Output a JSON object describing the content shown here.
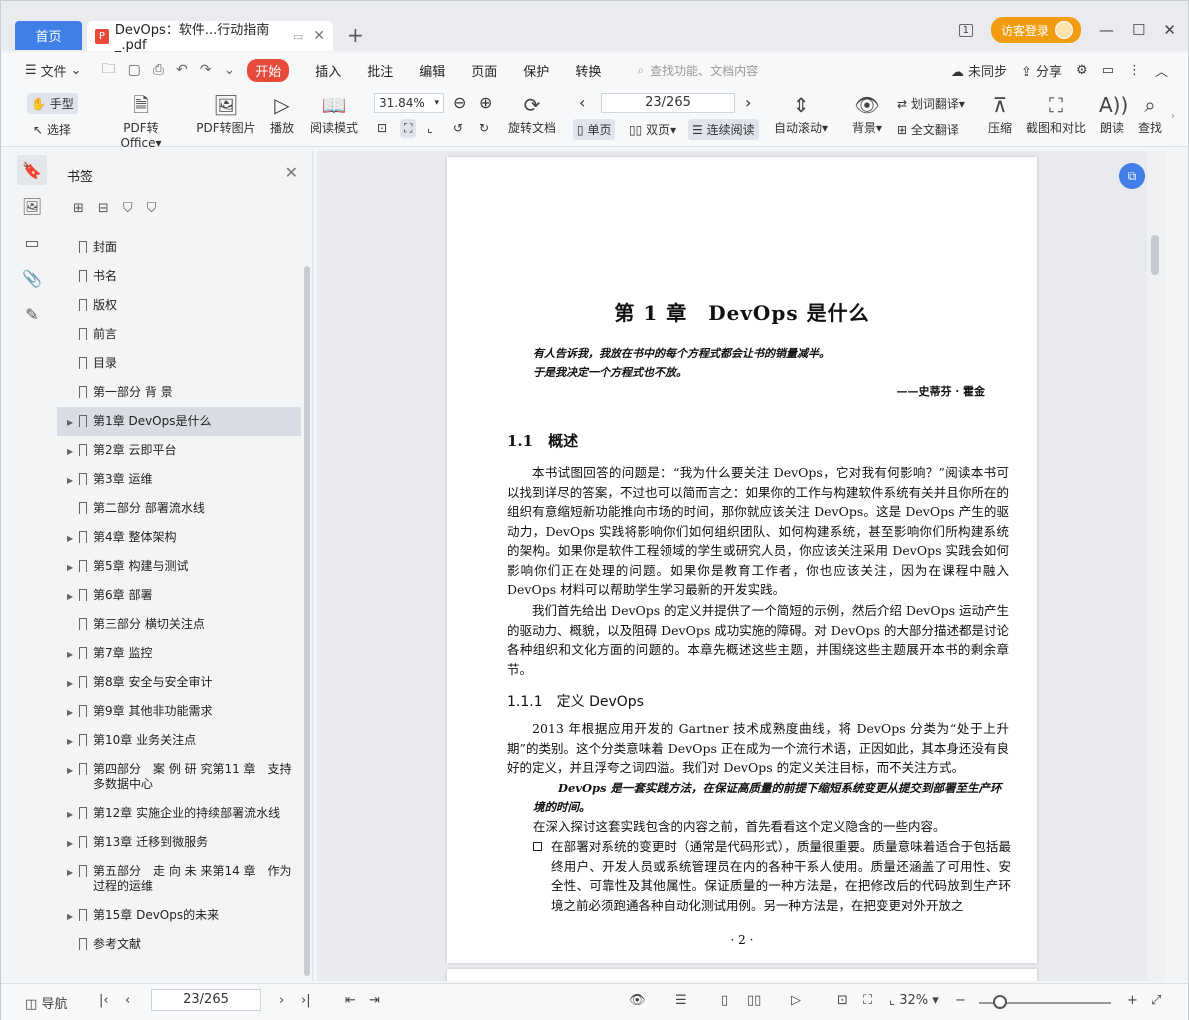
{
  "tabs": {
    "home": "首页",
    "doc_title": "DevOps：软件...行动指南_.pdf",
    "new_tab": "+"
  },
  "titlebar": {
    "page_badge": "1",
    "login": "访客登录",
    "minimize": "—",
    "maximize": "☐",
    "close": "✕"
  },
  "menu": {
    "file": "文件",
    "items": [
      "开始",
      "插入",
      "批注",
      "编辑",
      "页面",
      "保护",
      "转换"
    ],
    "active_item": "开始",
    "search_placeholder": "查找功能、文档内容",
    "sync": "未同步",
    "share": "分享"
  },
  "ribbon": {
    "hand": "手型",
    "select": "选择",
    "pdf_to_office": "PDF转Office",
    "pdf_to_image": "PDF转图片",
    "play": "播放",
    "read_mode": "阅读模式",
    "zoom_value": "31.84%",
    "rotate_doc": "旋转文档",
    "page_value": "23/265",
    "single_page": "单页",
    "double_page": "双页",
    "continuous_read": "连续阅读",
    "auto_scroll": "自动滚动",
    "background": "背景",
    "word_translate": "划词翻译",
    "full_translate": "全文翻译",
    "compress": "压缩",
    "screenshot_compare": "截图和对比",
    "read_aloud": "朗读",
    "find": "查找"
  },
  "bookmarks": {
    "title": "书签",
    "items": [
      {
        "label": "封面",
        "expandable": false
      },
      {
        "label": "书名",
        "expandable": false
      },
      {
        "label": "版权",
        "expandable": false
      },
      {
        "label": "前言",
        "expandable": false
      },
      {
        "label": "目录",
        "expandable": false
      },
      {
        "label": "第一部分 背 景",
        "expandable": false
      },
      {
        "label": "第1章 DevOps是什么",
        "expandable": true,
        "selected": true
      },
      {
        "label": "第2章 云即平台",
        "expandable": true
      },
      {
        "label": "第3章 运维",
        "expandable": true
      },
      {
        "label": "第二部分 部署流水线",
        "expandable": false
      },
      {
        "label": "第4章 整体架构",
        "expandable": true
      },
      {
        "label": "第5章 构建与测试",
        "expandable": true
      },
      {
        "label": "第6章 部署",
        "expandable": true
      },
      {
        "label": "第三部分 横切关注点",
        "expandable": false
      },
      {
        "label": "第7章 监控",
        "expandable": true
      },
      {
        "label": "第8章 安全与安全审计",
        "expandable": true
      },
      {
        "label": "第9章 其他非功能需求",
        "expandable": true
      },
      {
        "label": "第10章 业务关注点",
        "expandable": true
      },
      {
        "label": "第四部分　案 例 研 究第11 章　支持多数据中心",
        "expandable": true
      },
      {
        "label": "第12章 实施企业的持续部署流水线",
        "expandable": true
      },
      {
        "label": "第13章 迁移到微服务",
        "expandable": true
      },
      {
        "label": "第五部分　走 向 未 来第14 章　作为过程的运维",
        "expandable": true
      },
      {
        "label": "第15章 DevOps的未来",
        "expandable": true
      },
      {
        "label": "参考文献",
        "expandable": false
      }
    ]
  },
  "document": {
    "chapter_title": "第 1 章　DevOps 是什么",
    "epigraph_line1": "有人告诉我，我放在书中的每个方程式都会让书的销量减半。",
    "epigraph_line2": "于是我决定一个方程式也不放。",
    "epigraph_author": "——史蒂芬 · 霍金",
    "section_1_1": "1.1　概述",
    "para1": "本书试图回答的问题是：“我为什么要关注 DevOps，它对我有何影响？”阅读本书可以找到详尽的答案，不过也可以简而言之：如果你的工作与构建软件系统有关并且你所在的组织有意缩短新功能推向市场的时间，那你就应该关注 DevOps。这是 DevOps 产生的驱动力，DevOps 实践将影响你们如何组织团队、如何构建系统，甚至影响你们所构建系统的架构。如果你是软件工程领域的学生或研究人员，你应该关注采用 DevOps 实践会如何影响你们正在处理的问题。如果你是教育工作者，你也应该关注，因为在课程中融入 DevOps 材料可以帮助学生学习最新的开发实践。",
    "para2": "我们首先给出 DevOps 的定义并提供了一个简短的示例，然后介绍 DevOps 运动产生的驱动力、概貌，以及阻碍 DevOps 成功实施的障碍。对 DevOps 的大部分描述都是讨论各种组织和文化方面的问题的。本章先概述这些主题，并围绕这些主题展开本书的剩余章节。",
    "section_1_1_1": "1.1.1　定义 DevOps",
    "para3": "2013 年根据应用开发的 Gartner 技术成熟度曲线，将 DevOps 分类为“处于上升期”的类别。这个分类意味着 DevOps 正在成为一个流行术语，正因如此，其本身还没有良好的定义，并且浮夸之词四溢。我们对 DevOps 的定义关注目标，而不关注方式。",
    "definition": "DevOps 是一套实践方法，在保证高质量的前提下缩短系统变更从提交到部署至生产环境的时间。",
    "para4": "在深入探讨这套实践包含的内容之前，首先看看这个定义隐含的一些内容。",
    "bullet1": "在部署对系统的变更时（通常是代码形式），质量很重要。质量意味着适合于包括最终用户、开发人员或系统管理员在内的各种干系人使用。质量还涵盖了可用性、安全性、可靠性及其他属性。保证质量的一种方法是，在把修改后的代码放到生产环境之前必须跑通各种自动化测试用例。另一种方法是，在把变更对外开放之",
    "page_number": "· 2 ·"
  },
  "statusbar": {
    "nav": "导航",
    "page_value": "23/265",
    "zoom": "32%"
  }
}
